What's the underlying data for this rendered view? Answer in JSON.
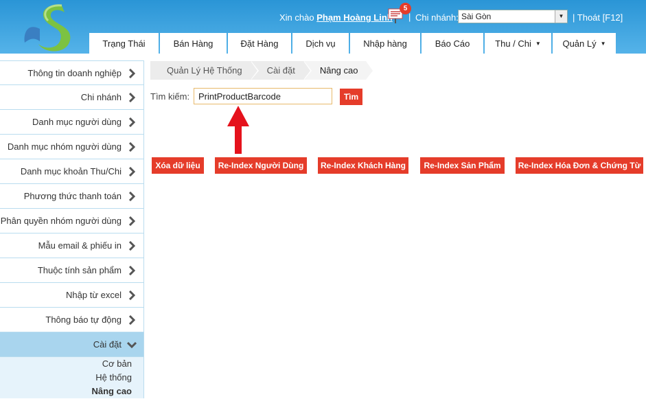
{
  "header": {
    "greeting": "Xin chào",
    "user_name": "Phạm Hoàng Linh",
    "notification_count": "5",
    "branch_label": "Chi nhánh:",
    "branch_value": "Sài Gòn",
    "logout": "Thoát [F12]",
    "separator": "|"
  },
  "nav": {
    "tabs": [
      {
        "label": "Trạng Thái"
      },
      {
        "label": "Bán Hàng"
      },
      {
        "label": "Đặt Hàng"
      },
      {
        "label": "Dịch vụ"
      },
      {
        "label": "Nhập hàng"
      },
      {
        "label": "Báo Cáo"
      },
      {
        "label": "Thu / Chi"
      },
      {
        "label": "Quản Lý"
      }
    ]
  },
  "sidebar": {
    "items": [
      {
        "label": "Thông tin doanh nghiệp"
      },
      {
        "label": "Chi nhánh"
      },
      {
        "label": "Danh mục người dùng"
      },
      {
        "label": "Danh mục nhóm người dùng"
      },
      {
        "label": "Danh mục khoản Thu/Chi"
      },
      {
        "label": "Phương thức thanh toán"
      },
      {
        "label": "Phân quyền nhóm người dùng"
      },
      {
        "label": "Mẫu email & phiếu in"
      },
      {
        "label": "Thuộc tính sản phẩm"
      },
      {
        "label": "Nhập từ excel"
      },
      {
        "label": "Thông báo tự động"
      },
      {
        "label": "Cài đặt"
      }
    ],
    "sub_items": [
      {
        "label": "Cơ bản"
      },
      {
        "label": "Hệ thống"
      },
      {
        "label": "Nâng cao"
      }
    ]
  },
  "breadcrumb": [
    "Quản Lý Hệ Thống",
    "Cài đặt",
    "Nâng cao"
  ],
  "search": {
    "label": "Tìm kiếm:",
    "value": "PrintProductBarcode",
    "button": "Tìm"
  },
  "actions": [
    {
      "label": "Xóa dữ liệu"
    },
    {
      "label": "Re-Index Người Dùng"
    },
    {
      "label": "Re-Index Khách Hàng"
    },
    {
      "label": "Re-Index Sản Phẩm"
    },
    {
      "label": "Re-Index Hóa Đơn & Chứng Từ"
    }
  ],
  "colors": {
    "header": "#2a95d6",
    "accent_red": "#e53c2a",
    "sidebar_active": "#a9d5ee",
    "sidebar_border": "#b9dcef"
  },
  "icons": {
    "logo": "s-fish-logo-icon",
    "notification": "message-board-icon",
    "chevron": "chevron-right-icon",
    "arrow": "red-up-arrow-icon"
  }
}
